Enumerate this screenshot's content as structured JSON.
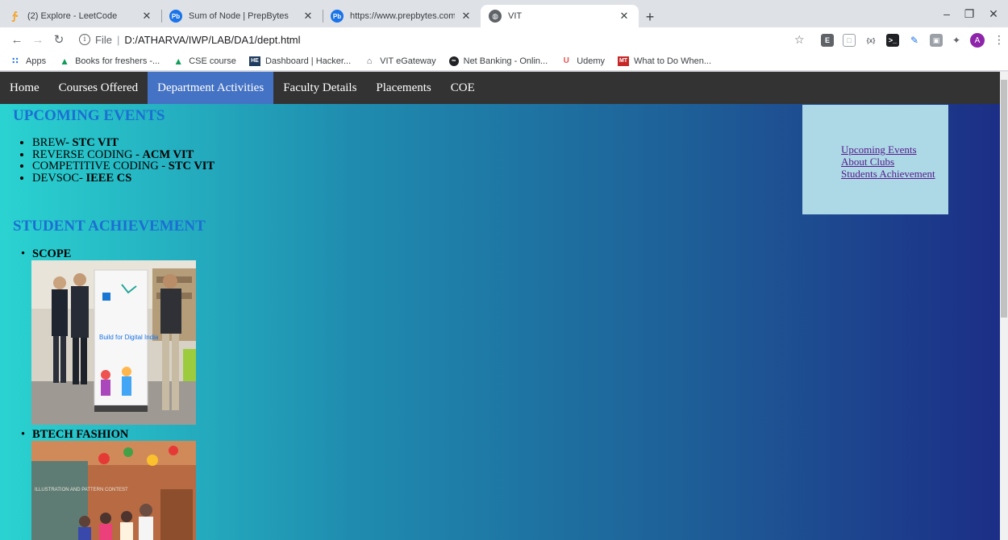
{
  "browser": {
    "tabs": [
      {
        "title": "(2) Explore - LeetCode",
        "favicon": "leetcode-icon",
        "active": false
      },
      {
        "title": "Sum of Node | PrepBytes",
        "favicon": "prepbytes-icon",
        "active": false
      },
      {
        "title": "https://www.prepbytes.com/pan",
        "favicon": "prepbytes-icon",
        "active": false
      },
      {
        "title": "VIT",
        "favicon": "globe-icon",
        "active": true
      }
    ],
    "address": {
      "scheme": "File",
      "path": "D:/ATHARVA/IWP/LAB/DA1/dept.html"
    },
    "profile_initial": "A",
    "bookmarks": [
      {
        "label": "Apps",
        "icon": "apps-grid-icon"
      },
      {
        "label": "Books for freshers -...",
        "icon": "google-drive-icon"
      },
      {
        "label": "CSE course",
        "icon": "google-drive-icon"
      },
      {
        "label": "Dashboard | Hacker...",
        "icon": "hackerearth-icon"
      },
      {
        "label": "VIT eGateway",
        "icon": "vit-icon"
      },
      {
        "label": "Net Banking - Onlin...",
        "icon": "bank-icon"
      },
      {
        "label": "Udemy",
        "icon": "udemy-icon"
      },
      {
        "label": "What to Do When...",
        "icon": "mt-icon"
      }
    ]
  },
  "page": {
    "nav": [
      "Home",
      "Courses Offered",
      "Department Activities",
      "Faculty Details",
      "Placements",
      "COE"
    ],
    "nav_active": "Department Activities",
    "upcoming_heading": "UPCOMING EVENTS",
    "events": [
      {
        "name": "BREW- ",
        "club": "STC VIT"
      },
      {
        "name": "REVERSE CODING - ",
        "club": "ACM VIT"
      },
      {
        "name": "COMPETITIVE CODING - ",
        "club": "STC VIT"
      },
      {
        "name": "DEVSOC- ",
        "club": "IEEE CS"
      }
    ],
    "achievement_heading": "STUDENT ACHIEVEMENT",
    "achievements": [
      {
        "title": "SCOPE",
        "photo_text": "Build for Digital India"
      },
      {
        "title": "BTECH FASHION",
        "photo_text": "ILLUSTRATION AND PATTERN CONTEST"
      }
    ],
    "sidebar_links": [
      "Upcoming Events",
      "About Clubs",
      "Students Achievement"
    ]
  },
  "colors": {
    "heading": "#1b6fd2",
    "nav_bg": "#333333",
    "nav_active": "#4472c4",
    "sidebar_bg": "#add8e6",
    "visited_link": "#551a8b"
  }
}
